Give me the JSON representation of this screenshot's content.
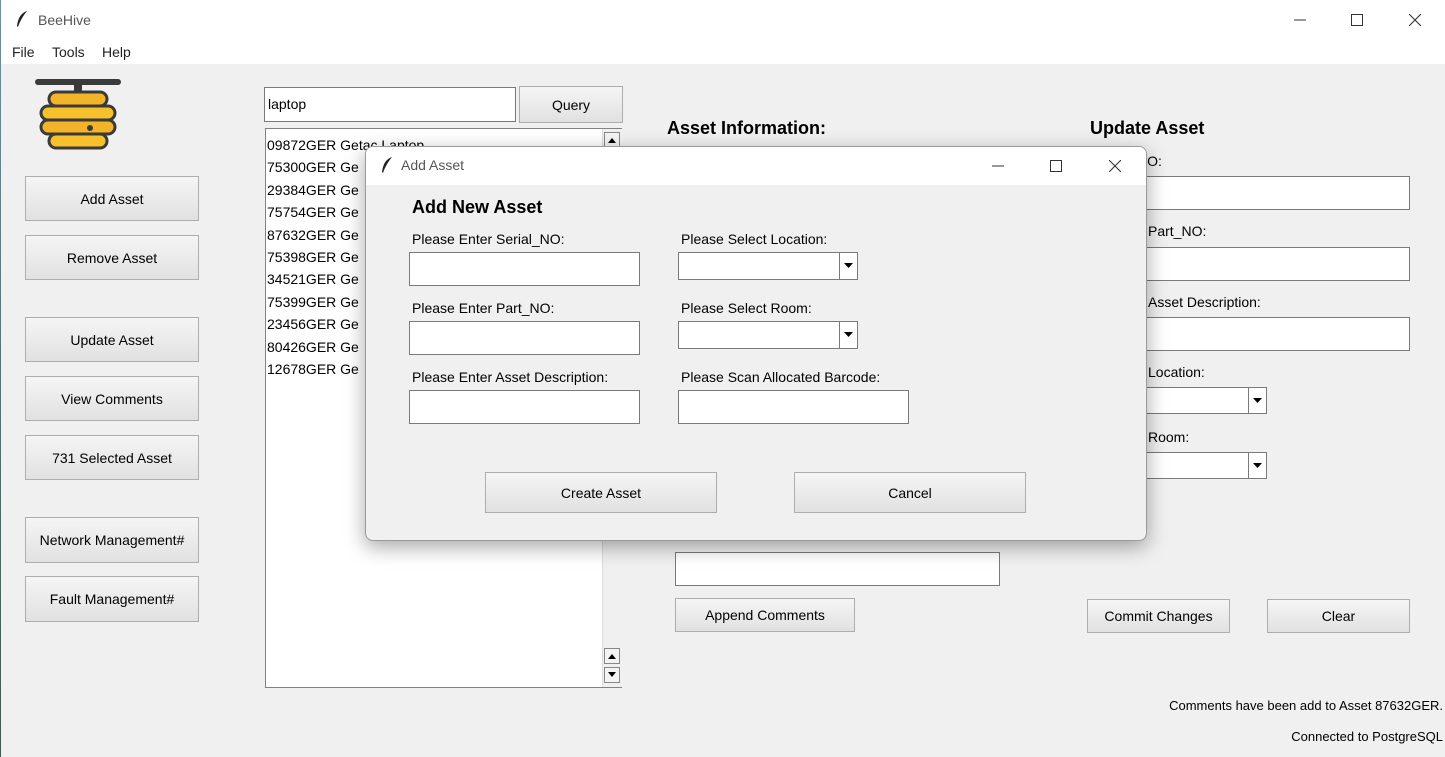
{
  "app": {
    "title": "BeeHive"
  },
  "menu": [
    "File",
    "Tools",
    "Help"
  ],
  "sidebar": {
    "buttons": [
      "Add Asset",
      "Remove Asset",
      "Update Asset",
      "View Comments",
      "731 Selected Asset",
      "Network Management#",
      "Fault Management#"
    ]
  },
  "search": {
    "value": "laptop",
    "query_label": "Query"
  },
  "asset_list": [
    "09872GER Getac Laptop",
    "75300GER Ge",
    "29384GER Ge",
    "75754GER Ge",
    "87632GER Ge",
    "75398GER Ge",
    "34521GER Ge",
    "75399GER Ge",
    "23456GER Ge",
    "80426GER Ge",
    "12678GER Ge"
  ],
  "asset_info": {
    "heading": "Asset Information:",
    "append_label": "Append Comments"
  },
  "update_asset": {
    "heading": "Update Asset",
    "labels": [
      "NO:",
      "Part_NO:",
      "Asset Description:",
      "Location:",
      "Room:"
    ],
    "commit_label": "Commit Changes",
    "clear_label": "Clear"
  },
  "status": {
    "message": "Comments have been add to Asset 87632GER.",
    "connection": "Connected to PostgreSQL"
  },
  "dialog": {
    "title": "Add Asset",
    "heading": "Add New Asset",
    "serial_label": "Please Enter Serial_NO:",
    "part_label": "Please Enter Part_NO:",
    "desc_label": "Please Enter Asset Description:",
    "location_label": "Please Select Location:",
    "room_label": "Please Select Room:",
    "barcode_label": "Please Scan Allocated Barcode:",
    "create_label": "Create Asset",
    "cancel_label": "Cancel"
  }
}
